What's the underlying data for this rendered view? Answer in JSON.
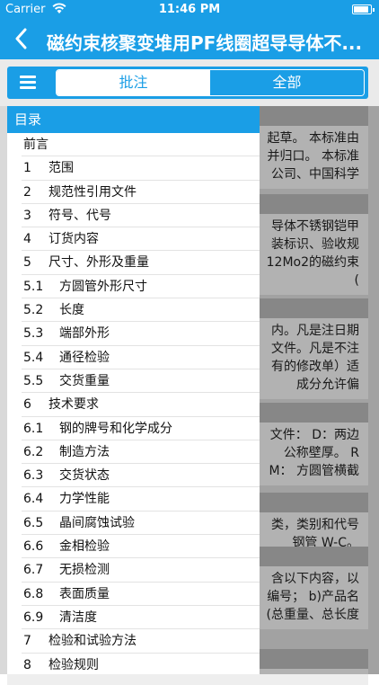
{
  "status_bar": {
    "carrier": "Carrier",
    "time": "11:46 PM"
  },
  "nav": {
    "title": "磁约束核聚变堆用PF线圈超导导体不..."
  },
  "toolbar": {
    "tabs": [
      "批注",
      "全部"
    ],
    "active_tab": "批注"
  },
  "drawer": {
    "header": "目录",
    "items": [
      {
        "num": "",
        "text": "前言"
      },
      {
        "num": "1",
        "text": "范围"
      },
      {
        "num": "2",
        "text": "规范性引用文件"
      },
      {
        "num": "3",
        "text": "符号、代号"
      },
      {
        "num": "4",
        "text": "订货内容"
      },
      {
        "num": "5",
        "text": "尺寸、外形及重量"
      },
      {
        "num": "5.1",
        "text": "方圆管外形尺寸"
      },
      {
        "num": "5.2",
        "text": "长度"
      },
      {
        "num": "5.3",
        "text": "端部外形"
      },
      {
        "num": "5.4",
        "text": "通径检验"
      },
      {
        "num": "5.5",
        "text": "交货重量"
      },
      {
        "num": "6",
        "text": "技术要求"
      },
      {
        "num": "6.1",
        "text": "钢的牌号和化学成分"
      },
      {
        "num": "6.2",
        "text": "制造方法"
      },
      {
        "num": "6.3",
        "text": "交货状态"
      },
      {
        "num": "6.4",
        "text": "力学性能"
      },
      {
        "num": "6.5",
        "text": "晶间腐蚀试验"
      },
      {
        "num": "6.6",
        "text": "金相检验"
      },
      {
        "num": "6.7",
        "text": "无损检测"
      },
      {
        "num": "6.8",
        "text": "表面质量"
      },
      {
        "num": "6.9",
        "text": "清洁度"
      },
      {
        "num": "7",
        "text": "检验和试验方法"
      },
      {
        "num": "8",
        "text": "检验规则"
      }
    ]
  },
  "cards": [
    {
      "body": "起草。 本标准由\n并归口。 本标准\n公司、中国科学"
    },
    {
      "body": "导体不锈钢铠甲\n装标识、验收规\n12Mo2的磁约束\n("
    },
    {
      "body": "内。凡是注日期\n文件。凡是不注\n有的修改单）适\n成分允许偏"
    },
    {
      "body": "文件： D：两边\n公称壁厚。 R\nM： 方圆管横截"
    },
    {
      "body": "类，类别和代号\n钢管 W-C。"
    },
    {
      "body": "含以下内容，以\n编号； b)产品名\n(总重量、总长度"
    }
  ]
}
